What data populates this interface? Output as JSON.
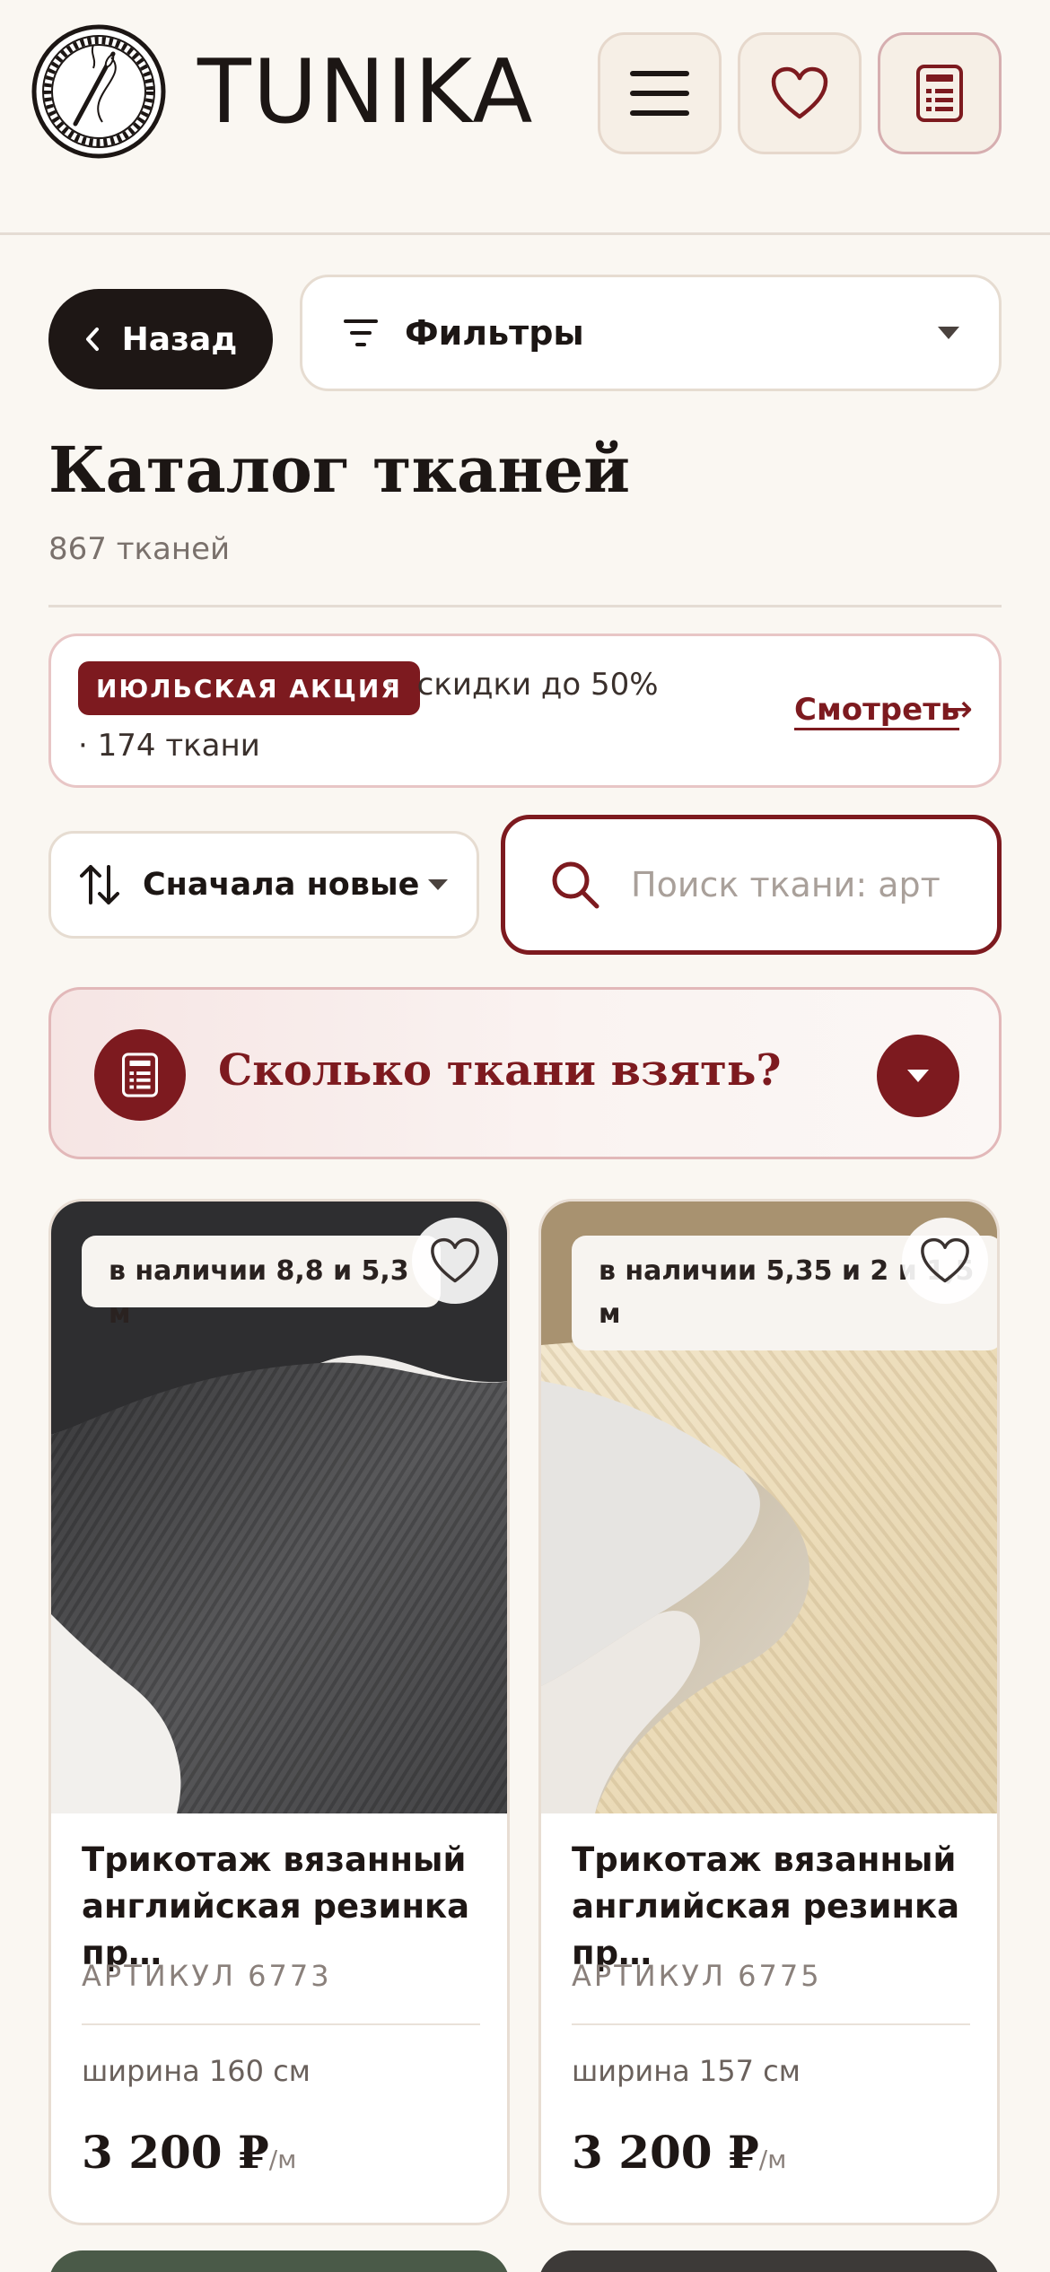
{
  "header": {
    "brand": "TUNIKA",
    "menu_icon": "hamburger-menu-icon",
    "favorites_icon": "heart-icon",
    "calculator_icon": "calculator-icon"
  },
  "nav": {
    "back_label": "Назад",
    "filters_label": "Фильтры"
  },
  "catalog": {
    "title": "Каталог тканей",
    "count": "867 тканей"
  },
  "promo": {
    "badge": "ИЮЛЬСКАЯ АКЦИЯ",
    "separator": "·",
    "discount": "скидки до 50%",
    "items": "· 174 ткани",
    "link": "Смотреть",
    "link_arrow": "→"
  },
  "sort": {
    "label": "Сначала новые"
  },
  "search": {
    "placeholder": "Поиск ткани: арт",
    "value": ""
  },
  "calculator": {
    "question": "Сколько ткани взять?"
  },
  "products": [
    {
      "stock": "в наличии 8,8 и 5,3 м",
      "name": "Трикотаж вязанный английская резинка пр…",
      "article": "АРТИКУЛ 6773",
      "width": "ширина 160 см",
      "price": "3 200 ₽",
      "unit": "/м",
      "color": "#4a4a4c"
    },
    {
      "stock": "в наличии 5,35 и 2 и 1,5 м",
      "name": "Трикотаж вязанный английская резинка пр…",
      "article": "АРТИКУЛ 6775",
      "width": "ширина 157 см",
      "price": "3 200 ₽",
      "unit": "/м",
      "color": "#ece0c4"
    }
  ],
  "colors": {
    "accent": "#7d1a1f",
    "dark": "#1e1715",
    "background": "#faf7f2"
  }
}
